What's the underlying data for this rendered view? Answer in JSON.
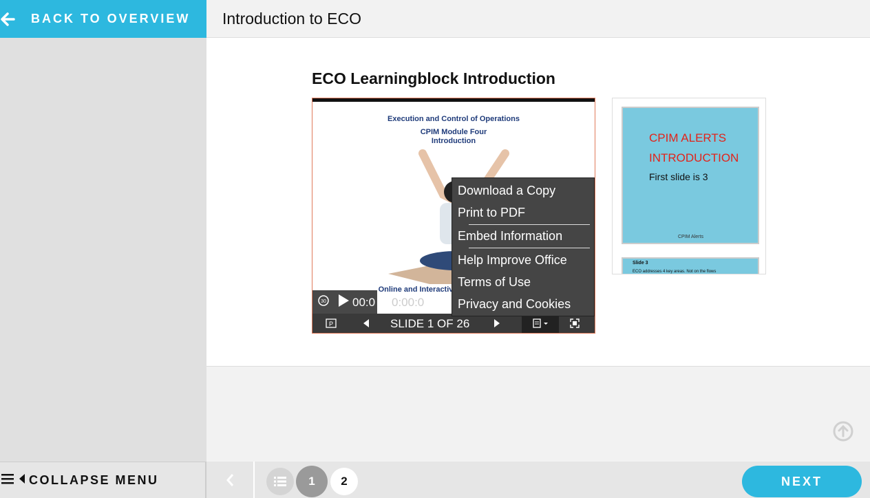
{
  "sidebar": {
    "back_label": "BACK TO OVERVIEW",
    "collapse_label": "COLLAPSE MENU"
  },
  "header": {
    "title": "Introduction to ECO"
  },
  "main": {
    "heading": "ECO Learningblock Introduction",
    "slide": {
      "line1": "Execution and Control of Operations",
      "line2": "CPIM Module Four",
      "line3": "Introduction",
      "footer_text": "Online and Interactiv"
    },
    "player": {
      "time_current": "00:0",
      "time_total": "0:00:0",
      "slide_counter": "SLIDE 1 OF 26"
    },
    "menu_items": [
      "Download a Copy",
      "Print to PDF",
      "Embed Information",
      "Help Improve Office",
      "Terms of Use",
      "Privacy and Cookies"
    ],
    "thumbnail": {
      "title_line1": "CPIM ALERTS",
      "title_line2": "INTRODUCTION",
      "subtitle": "First slide is 3",
      "footer": "CPIM Alerts",
      "next_title": "Slide 3",
      "next_body": "ECO addresses 4 key areas. Not on the flows"
    }
  },
  "pagination": {
    "page1": "1",
    "page2": "2",
    "next_label": "NEXT"
  },
  "colors": {
    "accent": "#2db8df",
    "thumb_bg": "#7ac9df",
    "thumb_title": "#e2231a"
  }
}
